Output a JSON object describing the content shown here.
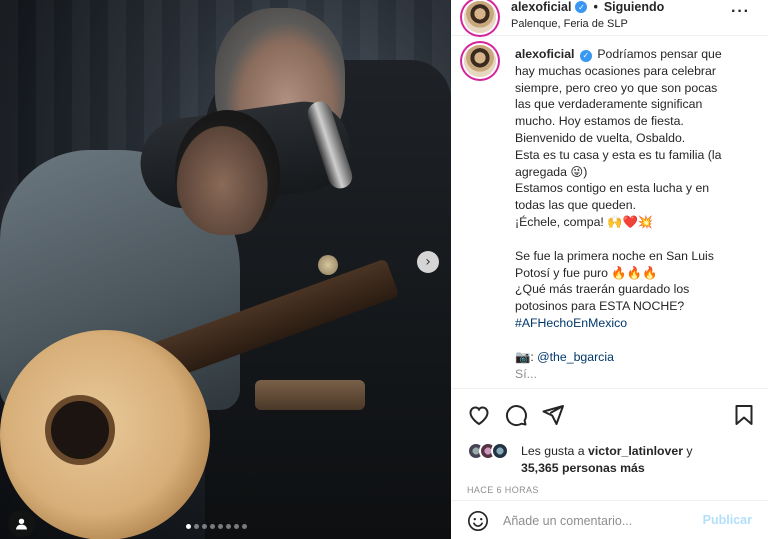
{
  "header": {
    "username": "alexoficial",
    "separator": "•",
    "follow_status": "Siguiendo",
    "location": "Palenque, Feria de SLP",
    "more_icon": "more-horizontal-icon"
  },
  "caption": {
    "username": "alexoficial",
    "lines": [
      "Podríamos pensar que",
      "hay muchas ocasiones para celebrar",
      "siempre, pero creo yo que son pocas",
      "las que verdaderamente significan",
      "mucho. Hoy estamos de fiesta.",
      "Bienvenido de vuelta, Osbaldo.",
      "Esta es tu casa y esta es tu familia (la",
      "agregada 😜)",
      "Estamos contigo en esta lucha y en",
      "todas las que queden.",
      "¡Échele, compa! 🙌❤️💥",
      "",
      "Se fue la primera noche en San Luis",
      "Potosí y fue puro 🔥🔥🔥",
      "¿Qué más traerán guardado los",
      "potosinos para ESTA NOCHE?"
    ],
    "hashtag": "#AFHechoEnMexico",
    "credit_emoji": "📷",
    "credit_mention": "@the_bgarcia",
    "cut_line": "Sí..."
  },
  "carousel": {
    "total": 8,
    "active": 0
  },
  "actions": {
    "like_icon": "heart-icon",
    "comment_icon": "comment-icon",
    "share_icon": "send-icon",
    "save_icon": "bookmark-icon"
  },
  "likes": {
    "prefix": "Les gusta a ",
    "user": "victor_latinlover",
    "conj": " y",
    "count": "35,365 personas más"
  },
  "timestamp": "HACE 6 HORAS",
  "comment": {
    "placeholder": "Añade un comentario...",
    "publish": "Publicar"
  },
  "colors": {
    "link": "#00376b",
    "verified": "#3897f0",
    "publish_disabled": "#b2dffc",
    "muted": "#8e8e8e"
  }
}
